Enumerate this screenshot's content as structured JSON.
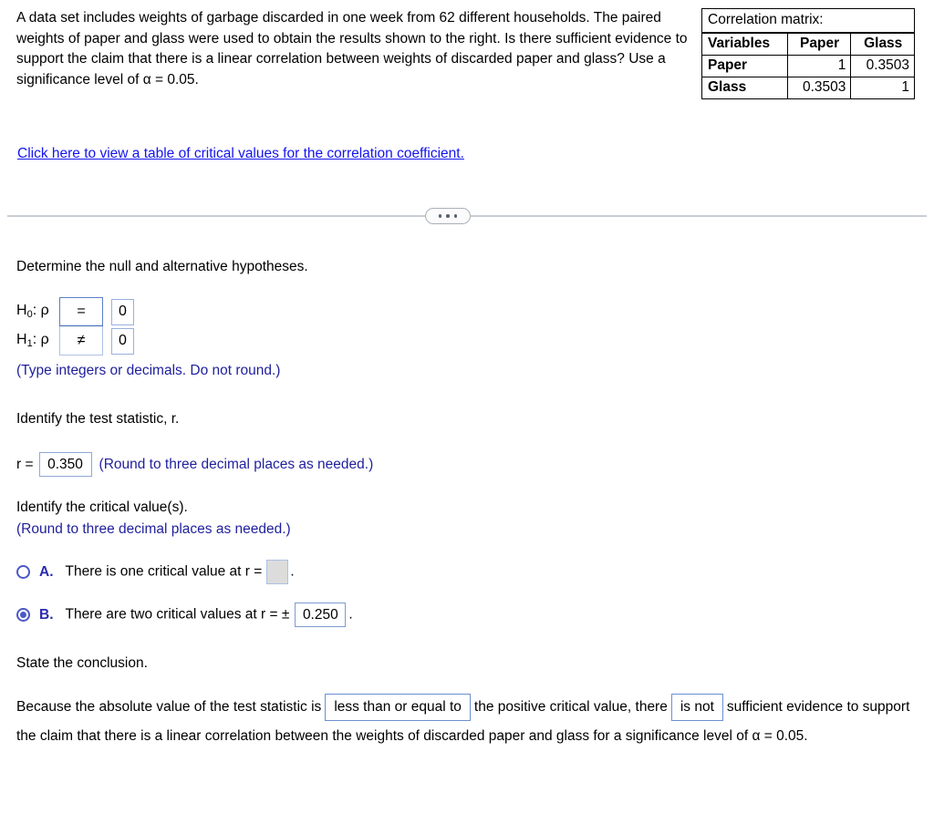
{
  "problem": {
    "statement_part1": "A data set includes weights of garbage discarded in one week from 62 different households. The paired weights of paper and glass were used to obtain the results shown to the right. Is there sufficient evidence to support the claim that there is a linear correlation between weights of discarded paper and glass? Use a significance level of ",
    "statement_alpha": "α = 0.05.",
    "link_text": "Click here to view a table of critical values for the correlation coefficient."
  },
  "corr_matrix": {
    "title": "Correlation matrix:",
    "headers": [
      "Variables",
      "Paper",
      "Glass"
    ],
    "rows": [
      {
        "label": "Paper",
        "values": [
          "1",
          "0.3503"
        ]
      },
      {
        "label": "Glass",
        "values": [
          "0.3503",
          "1"
        ]
      }
    ]
  },
  "divider": {
    "dots_label": "•••"
  },
  "hypotheses": {
    "prompt": "Determine the null and alternative hypotheses.",
    "null_label": "H",
    "null_sub": "0",
    "null_tail": ": ρ",
    "null_operator": "=",
    "null_value": "0",
    "alt_label": "H",
    "alt_sub": "1",
    "alt_tail": ": ρ",
    "alt_operator": "≠",
    "alt_value": "0",
    "hint": "(Type integers or decimals. Do not round.)"
  },
  "test_statistic": {
    "prompt": "Identify the test statistic, r.",
    "lead": "r =",
    "value": "0.350",
    "note": "(Round to three decimal places as needed.)"
  },
  "critical_values": {
    "prompt": "Identify the critical value(s).",
    "hint": "(Round to three decimal places as needed.)",
    "options": [
      {
        "letter": "A.",
        "selected": false,
        "text_before": "There is one critical value at r =",
        "value": "",
        "text_after": "."
      },
      {
        "letter": "B.",
        "selected": true,
        "text_before": "There are two critical values at r = ±",
        "value": "0.250",
        "text_after": "."
      }
    ]
  },
  "conclusion": {
    "prompt": "State the conclusion.",
    "text_1": "Because the absolute value of the test statistic is",
    "dropdown_1": "less than or equal to",
    "text_2": "the positive critical value, there",
    "dropdown_2": "is not",
    "text_3": "sufficient evidence to support the claim that there is a linear correlation between the weights of discarded paper and glass for a significance level of α = 0.05."
  },
  "colors": {
    "link_blue": "#1414ee",
    "hint_blue": "#1f1f9c",
    "radio_blue": "#4a58c8",
    "input_border": "#7e9ad4",
    "disabled_fill": "#dcdcdc"
  }
}
